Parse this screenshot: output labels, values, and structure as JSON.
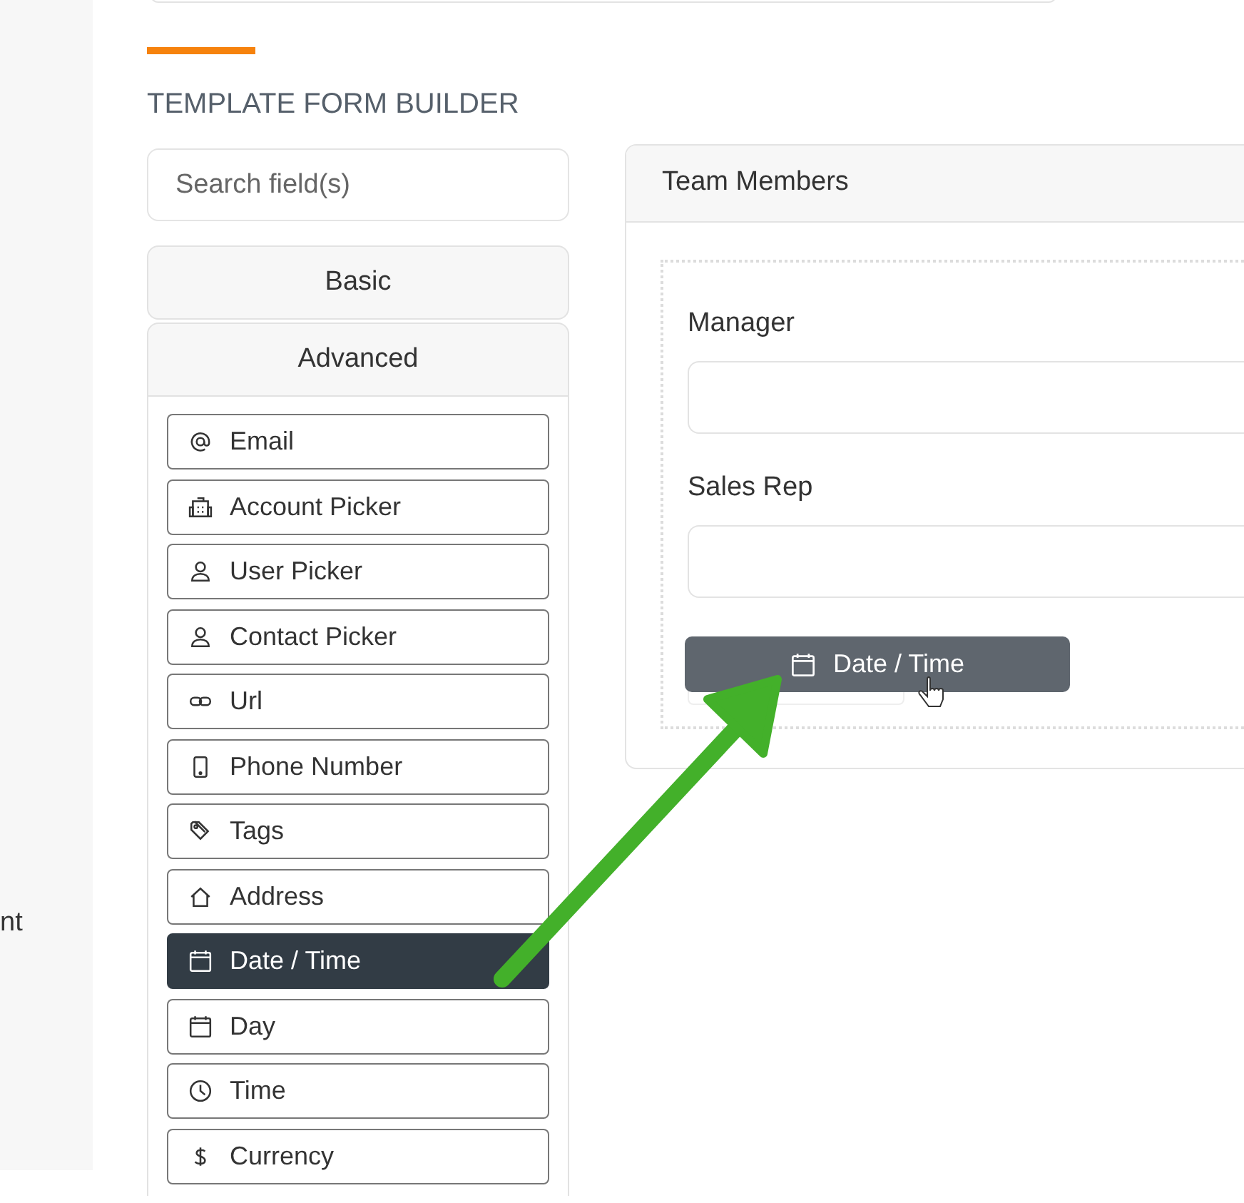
{
  "side_panel": {
    "text": "nt"
  },
  "page": {
    "title": "TEMPLATE FORM BUILDER"
  },
  "search": {
    "placeholder": "Search field(s)"
  },
  "sections": [
    {
      "label": "Basic",
      "expanded": false
    },
    {
      "label": "Advanced",
      "expanded": true
    }
  ],
  "fields": [
    {
      "label": "Email",
      "kind": "email",
      "selected": false
    },
    {
      "label": "Account Picker",
      "kind": "account",
      "selected": false
    },
    {
      "label": "User Picker",
      "kind": "user",
      "selected": false
    },
    {
      "label": "Contact Picker",
      "kind": "contact",
      "selected": false
    },
    {
      "label": "Url",
      "kind": "url",
      "selected": false
    },
    {
      "label": "Phone Number",
      "kind": "phone",
      "selected": false
    },
    {
      "label": "Tags",
      "kind": "tags",
      "selected": false
    },
    {
      "label": "Address",
      "kind": "address",
      "selected": false
    },
    {
      "label": "Date / Time",
      "kind": "datetime",
      "selected": true
    },
    {
      "label": "Day",
      "kind": "day",
      "selected": false
    },
    {
      "label": "Time",
      "kind": "time",
      "selected": false
    },
    {
      "label": "Currency",
      "kind": "currency",
      "selected": false
    }
  ],
  "form": {
    "section_title": "Team Members",
    "fields": [
      {
        "label": "Manager"
      },
      {
        "label": "Sales Rep"
      }
    ]
  },
  "dragging": {
    "label": "Date / Time",
    "kind": "datetime"
  }
}
